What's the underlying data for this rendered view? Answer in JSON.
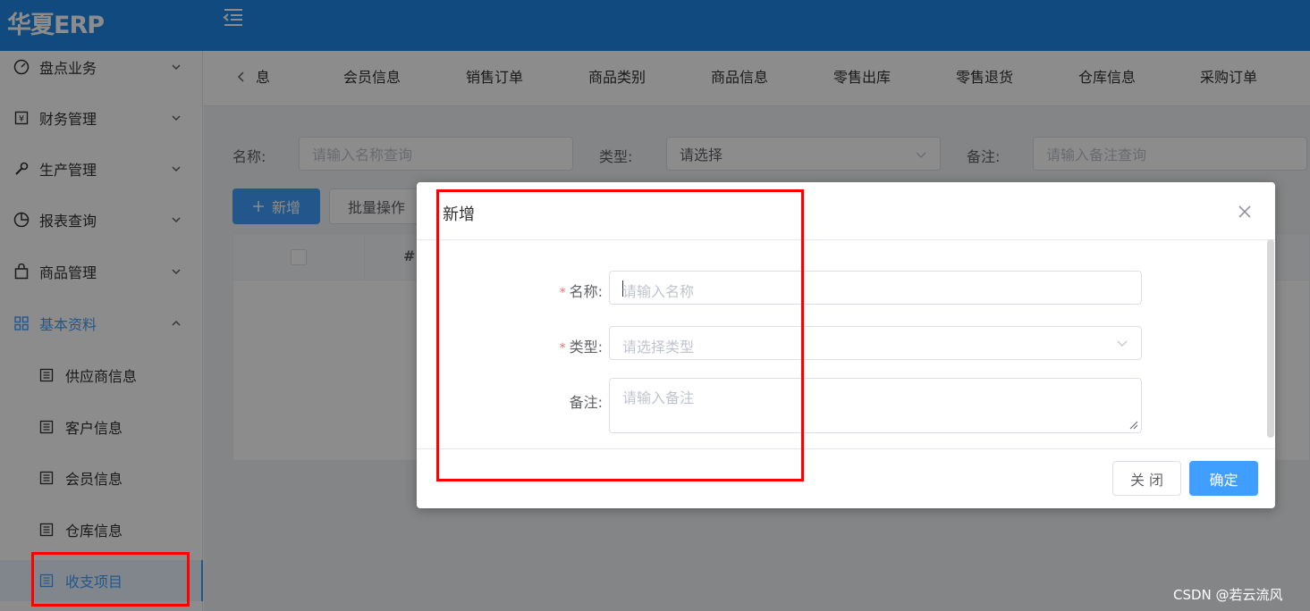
{
  "app": {
    "logo": "华夏ERP",
    "accent": "#1e88e5"
  },
  "sidebar": {
    "items": [
      {
        "label": "盘点业务",
        "icon": "dashboard-icon"
      },
      {
        "label": "财务管理",
        "icon": "finance-icon"
      },
      {
        "label": "生产管理",
        "icon": "wrench-icon"
      },
      {
        "label": "报表查询",
        "icon": "pie-chart-icon"
      },
      {
        "label": "商品管理",
        "icon": "bag-icon"
      },
      {
        "label": "基本资料",
        "icon": "grid-icon",
        "open": true
      }
    ],
    "sub_items": [
      {
        "label": "供应商信息"
      },
      {
        "label": "客户信息"
      },
      {
        "label": "会员信息"
      },
      {
        "label": "仓库信息"
      },
      {
        "label": "收支项目",
        "active": true
      }
    ]
  },
  "tabs": [
    "息",
    "会员信息",
    "销售订单",
    "商品类别",
    "商品信息",
    "零售出库",
    "零售退货",
    "仓库信息",
    "采购订单"
  ],
  "filters": {
    "name_label": "名称:",
    "name_placeholder": "请输入名称查询",
    "type_label": "类型:",
    "type_value": "请选择",
    "remark_label": "备注:",
    "remark_placeholder": "请输入备注查询"
  },
  "toolbar": {
    "add_label": "新增",
    "batch_label": "批量操作"
  },
  "table": {
    "num_header": "#"
  },
  "dialog": {
    "title": "新增",
    "fields": {
      "name_label": "名称:",
      "name_placeholder": "请输入名称",
      "type_label": "类型:",
      "type_placeholder": "请选择类型",
      "remark_label": "备注:",
      "remark_placeholder": "请输入备注"
    },
    "required_mark": "*",
    "close_label": "关 闭",
    "ok_label": "确定"
  },
  "watermark": "CSDN @若云流风"
}
